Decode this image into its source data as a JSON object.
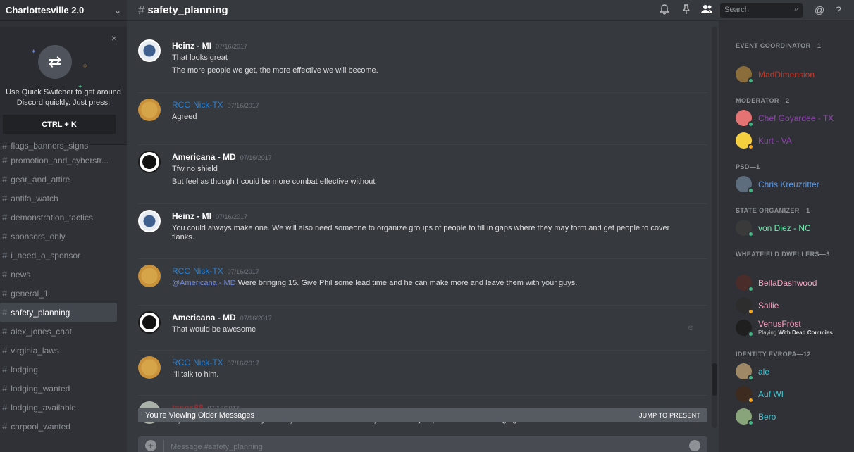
{
  "server": {
    "name": "Charlottesville 2.0"
  },
  "quick_switcher": {
    "description": "Use Quick Switcher to get around Discord quickly. Just press:",
    "shortcut": "CTRL + K",
    "close_glyph": "×"
  },
  "channels": [
    {
      "name": "flags_banners_signs",
      "state": "cut"
    },
    {
      "name": "promotion_and_cyberstr...",
      "state": "normal"
    },
    {
      "name": "gear_and_attire",
      "state": "normal"
    },
    {
      "name": "antifa_watch",
      "state": "normal"
    },
    {
      "name": "demonstration_tactics",
      "state": "normal"
    },
    {
      "name": "sponsors_only",
      "state": "normal"
    },
    {
      "name": "i_need_a_sponsor",
      "state": "normal"
    },
    {
      "name": "news",
      "state": "normal"
    },
    {
      "name": "general_1",
      "state": "normal"
    },
    {
      "name": "safety_planning",
      "state": "active"
    },
    {
      "name": "alex_jones_chat",
      "state": "normal"
    },
    {
      "name": "virginia_laws",
      "state": "normal"
    },
    {
      "name": "lodging",
      "state": "normal"
    },
    {
      "name": "lodging_wanted",
      "state": "normal"
    },
    {
      "name": "lodging_available",
      "state": "normal"
    },
    {
      "name": "carpool_wanted",
      "state": "normal"
    }
  ],
  "channel_header": {
    "hash": "#",
    "title": "safety_planning"
  },
  "search": {
    "placeholder": "Search"
  },
  "messages": [
    {
      "author": "Heinz - MI",
      "time": "07/16/2017",
      "author_style": "white",
      "avatar": "eagle",
      "lines": [
        "That looks great",
        "The more people we get, the more effective we will become."
      ]
    },
    {
      "author": "RCO Nick-TX",
      "time": "07/16/2017",
      "author_style": "blue",
      "avatar": "rco",
      "lines": [
        "Agreed"
      ]
    },
    {
      "author": "Americana - MD",
      "time": "07/16/2017",
      "author_style": "white",
      "avatar": "americana",
      "lines": [
        "Tfw no shield",
        "But feel as though I could be more combat effective without"
      ]
    },
    {
      "author": "Heinz - MI",
      "time": "07/16/2017",
      "author_style": "white",
      "avatar": "eagle",
      "lines": [
        "You could always make one. We will also need someone to organize groups of people to fill in gaps where they may form and get people to cover flanks."
      ]
    },
    {
      "author": "RCO Nick-TX",
      "time": "07/16/2017",
      "author_style": "blue",
      "avatar": "rco",
      "mention": "@Americana - MD",
      "lines": [
        " Were bringing 15. Give Phil some lead time and he can make more and leave them with your guys."
      ]
    },
    {
      "author": "Americana - MD",
      "time": "07/16/2017",
      "author_style": "white",
      "avatar": "americana",
      "lines": [
        "That would be awesome"
      ]
    },
    {
      "author": "RCO Nick-TX",
      "time": "07/16/2017",
      "author_style": "blue",
      "avatar": "rco",
      "lines": [
        "I'll talk to him."
      ]
    },
    {
      "author": "tacos88",
      "time": "07/16/2017",
      "author_style": "red",
      "avatar": "tacos",
      "lines": [
        "myself and 2 others for any security needed. We are military and security experienced. Ill be bringing a shield and"
      ]
    }
  ],
  "older_banner": {
    "text": "You're Viewing Older Messages",
    "action": "Jump to present"
  },
  "composer": {
    "placeholder": "Message #safety_planning",
    "plus": "+"
  },
  "member_groups": [
    {
      "title": "Event Coordinator—1",
      "members": [
        {
          "name": "MadDimension",
          "color": "#c0392b",
          "status": "#43b581"
        }
      ]
    },
    {
      "title": "Moderator—2",
      "members": [
        {
          "name": "Chef Goyardee - TX",
          "color": "#8e44ad",
          "status": "#43b581"
        },
        {
          "name": "Kurt - VA",
          "color": "#8e44ad",
          "status": "#faa61a"
        }
      ]
    },
    {
      "title": "PSD—1",
      "members": [
        {
          "name": "Chris Kreuzritter",
          "color": "#5d9be8",
          "status": "#43b581"
        }
      ]
    },
    {
      "title": "State Organizer—1",
      "members": [
        {
          "name": "von Diez - NC",
          "color": "#69f0ae",
          "status": "#43b581"
        }
      ]
    },
    {
      "title": "Wheatfield Dwellers—3",
      "members": [
        {
          "name": "BellaDashwood",
          "color": "#f8a5c2",
          "status": "#43b581"
        },
        {
          "name": "Sallie",
          "color": "#f8a5c2",
          "status": "#faa61a"
        },
        {
          "name": "VenusFröst",
          "color": "#f8a5c2",
          "status": "#43b581",
          "activity_prefix": "Playing ",
          "activity": "With Dead Commies"
        }
      ]
    },
    {
      "title": "Identity Evropa—12",
      "members": [
        {
          "name": "ale",
          "color": "#40c4d0",
          "status": "#43b581"
        },
        {
          "name": "Auf WI",
          "color": "#40c4d0",
          "status": "#faa61a"
        },
        {
          "name": "Bero",
          "color": "#40c4d0",
          "status": "#43b581"
        }
      ]
    }
  ],
  "icons": [
    "bell-icon",
    "pin-icon",
    "members-icon",
    "search-icon",
    "mention-icon",
    "help-icon"
  ]
}
